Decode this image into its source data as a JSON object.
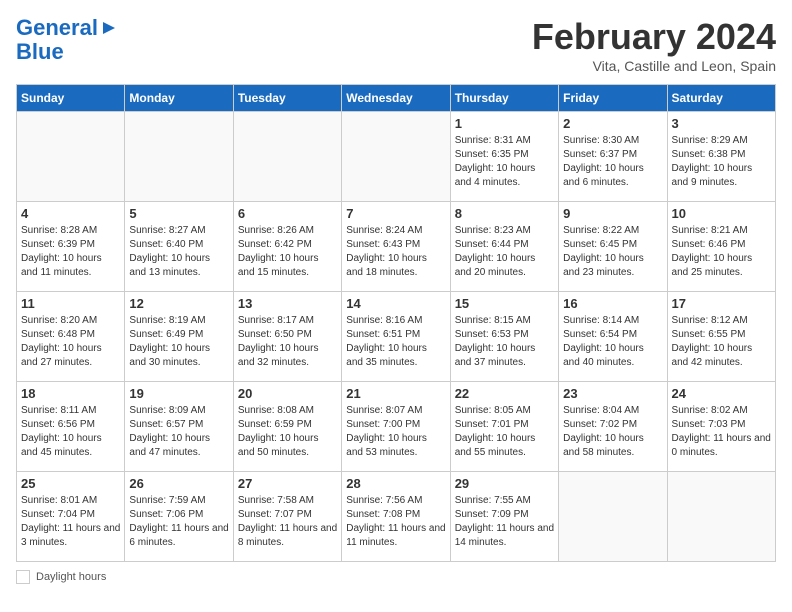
{
  "header": {
    "logo_line1": "General",
    "logo_line2": "Blue",
    "month": "February 2024",
    "location": "Vita, Castille and Leon, Spain"
  },
  "days_of_week": [
    "Sunday",
    "Monday",
    "Tuesday",
    "Wednesday",
    "Thursday",
    "Friday",
    "Saturday"
  ],
  "weeks": [
    [
      {
        "day": "",
        "info": ""
      },
      {
        "day": "",
        "info": ""
      },
      {
        "day": "",
        "info": ""
      },
      {
        "day": "",
        "info": ""
      },
      {
        "day": "1",
        "info": "Sunrise: 8:31 AM\nSunset: 6:35 PM\nDaylight: 10 hours\nand 4 minutes."
      },
      {
        "day": "2",
        "info": "Sunrise: 8:30 AM\nSunset: 6:37 PM\nDaylight: 10 hours\nand 6 minutes."
      },
      {
        "day": "3",
        "info": "Sunrise: 8:29 AM\nSunset: 6:38 PM\nDaylight: 10 hours\nand 9 minutes."
      }
    ],
    [
      {
        "day": "4",
        "info": "Sunrise: 8:28 AM\nSunset: 6:39 PM\nDaylight: 10 hours\nand 11 minutes."
      },
      {
        "day": "5",
        "info": "Sunrise: 8:27 AM\nSunset: 6:40 PM\nDaylight: 10 hours\nand 13 minutes."
      },
      {
        "day": "6",
        "info": "Sunrise: 8:26 AM\nSunset: 6:42 PM\nDaylight: 10 hours\nand 15 minutes."
      },
      {
        "day": "7",
        "info": "Sunrise: 8:24 AM\nSunset: 6:43 PM\nDaylight: 10 hours\nand 18 minutes."
      },
      {
        "day": "8",
        "info": "Sunrise: 8:23 AM\nSunset: 6:44 PM\nDaylight: 10 hours\nand 20 minutes."
      },
      {
        "day": "9",
        "info": "Sunrise: 8:22 AM\nSunset: 6:45 PM\nDaylight: 10 hours\nand 23 minutes."
      },
      {
        "day": "10",
        "info": "Sunrise: 8:21 AM\nSunset: 6:46 PM\nDaylight: 10 hours\nand 25 minutes."
      }
    ],
    [
      {
        "day": "11",
        "info": "Sunrise: 8:20 AM\nSunset: 6:48 PM\nDaylight: 10 hours\nand 27 minutes."
      },
      {
        "day": "12",
        "info": "Sunrise: 8:19 AM\nSunset: 6:49 PM\nDaylight: 10 hours\nand 30 minutes."
      },
      {
        "day": "13",
        "info": "Sunrise: 8:17 AM\nSunset: 6:50 PM\nDaylight: 10 hours\nand 32 minutes."
      },
      {
        "day": "14",
        "info": "Sunrise: 8:16 AM\nSunset: 6:51 PM\nDaylight: 10 hours\nand 35 minutes."
      },
      {
        "day": "15",
        "info": "Sunrise: 8:15 AM\nSunset: 6:53 PM\nDaylight: 10 hours\nand 37 minutes."
      },
      {
        "day": "16",
        "info": "Sunrise: 8:14 AM\nSunset: 6:54 PM\nDaylight: 10 hours\nand 40 minutes."
      },
      {
        "day": "17",
        "info": "Sunrise: 8:12 AM\nSunset: 6:55 PM\nDaylight: 10 hours\nand 42 minutes."
      }
    ],
    [
      {
        "day": "18",
        "info": "Sunrise: 8:11 AM\nSunset: 6:56 PM\nDaylight: 10 hours\nand 45 minutes."
      },
      {
        "day": "19",
        "info": "Sunrise: 8:09 AM\nSunset: 6:57 PM\nDaylight: 10 hours\nand 47 minutes."
      },
      {
        "day": "20",
        "info": "Sunrise: 8:08 AM\nSunset: 6:59 PM\nDaylight: 10 hours\nand 50 minutes."
      },
      {
        "day": "21",
        "info": "Sunrise: 8:07 AM\nSunset: 7:00 PM\nDaylight: 10 hours\nand 53 minutes."
      },
      {
        "day": "22",
        "info": "Sunrise: 8:05 AM\nSunset: 7:01 PM\nDaylight: 10 hours\nand 55 minutes."
      },
      {
        "day": "23",
        "info": "Sunrise: 8:04 AM\nSunset: 7:02 PM\nDaylight: 10 hours\nand 58 minutes."
      },
      {
        "day": "24",
        "info": "Sunrise: 8:02 AM\nSunset: 7:03 PM\nDaylight: 11 hours\nand 0 minutes."
      }
    ],
    [
      {
        "day": "25",
        "info": "Sunrise: 8:01 AM\nSunset: 7:04 PM\nDaylight: 11 hours\nand 3 minutes."
      },
      {
        "day": "26",
        "info": "Sunrise: 7:59 AM\nSunset: 7:06 PM\nDaylight: 11 hours\nand 6 minutes."
      },
      {
        "day": "27",
        "info": "Sunrise: 7:58 AM\nSunset: 7:07 PM\nDaylight: 11 hours\nand 8 minutes."
      },
      {
        "day": "28",
        "info": "Sunrise: 7:56 AM\nSunset: 7:08 PM\nDaylight: 11 hours\nand 11 minutes."
      },
      {
        "day": "29",
        "info": "Sunrise: 7:55 AM\nSunset: 7:09 PM\nDaylight: 11 hours\nand 14 minutes."
      },
      {
        "day": "",
        "info": ""
      },
      {
        "day": "",
        "info": ""
      }
    ]
  ],
  "footer": {
    "label": "Daylight hours"
  }
}
